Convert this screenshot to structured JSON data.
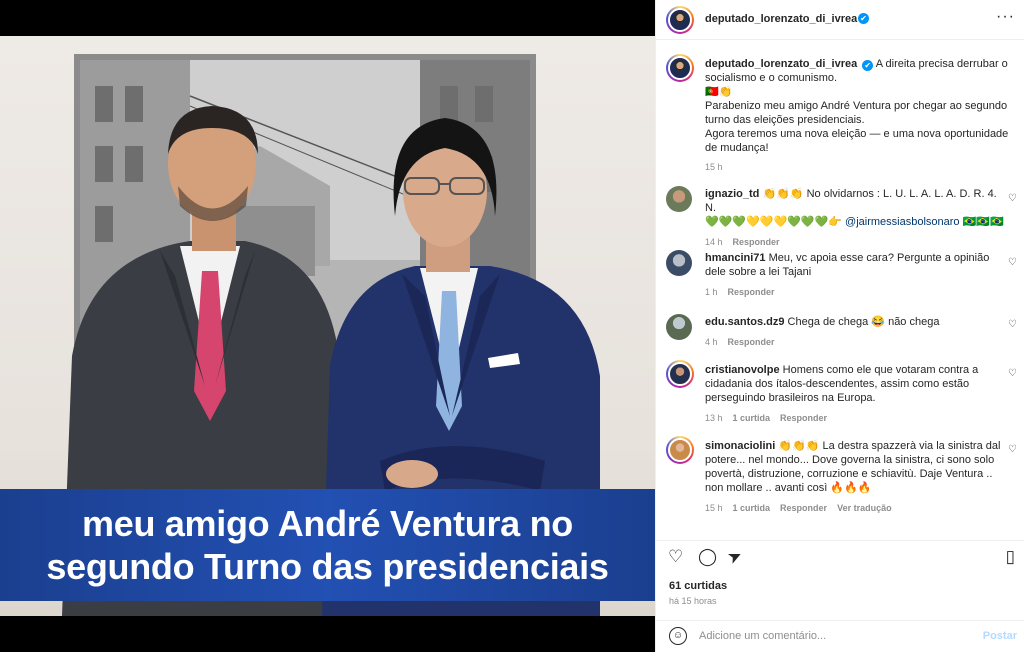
{
  "post": {
    "overlay_line1": "meu amigo André Ventura no",
    "overlay_line2": "segundo Turno das presidenciais"
  },
  "header": {
    "username": "deputado_lorenzato_di_ivrea",
    "verified_icon": "✔",
    "more_icon": "···"
  },
  "caption": {
    "username": "deputado_lorenzato_di_ivrea",
    "line1": "A direita precisa derrubar o",
    "line2": "socialismo e o comunismo.",
    "line3": "🇵🇹👏",
    "line4": "Parabenizo meu amigo André Ventura por chegar ao segundo",
    "line5": "turno das eleições presidenciais.",
    "line6": "Agora teremos uma nova eleição — e uma nova oportunidade",
    "line7": "de mudança!",
    "time": "15 h"
  },
  "comments": [
    {
      "username": "ignazio_td",
      "line1": "👏👏👏 No olvidarnos : L. U. L. A. L. A. D. R. 4. N.",
      "line2_emoji": "💚💚💚💛💛💛💚💚💚👉",
      "line2_mention": "@jairmessiasbolsonaro",
      "line2_tail": "🇧🇷🇧🇷🇧🇷",
      "time": "14 h",
      "reply": "Responder"
    },
    {
      "username": "hmancini71",
      "line1": "Meu, vc apoia esse cara? Pergunte a opinião",
      "line2": "dele sobre a lei Tajani",
      "time": "1 h",
      "reply": "Responder"
    },
    {
      "username": "edu.santos.dz9",
      "line1": "Chega de chega 😂 não chega",
      "time": "4 h",
      "reply": "Responder"
    },
    {
      "username": "cristianovolpe",
      "line1": "Homens como ele que votaram contra a",
      "line2": "cidadania dos ítalos-descendentes, assim como estão",
      "line3": "perseguindo brasileiros na Europa.",
      "time": "13 h",
      "likes": "1 curtida",
      "reply": "Responder"
    },
    {
      "username": "simonaciolini",
      "line1": "👏👏👏 La destra spazzerà via la sinistra dal",
      "line2": "potere... nel mondo... Dove governa la sinistra, ci sono solo",
      "line3": "povertà, distruzione, corruzione e schiavitù. Daje Ventura ..",
      "line4": "non mollare .. avanti così 🔥🔥🔥",
      "time": "15 h",
      "likes": "1 curtida",
      "reply": "Responder",
      "translate": "Ver tradução"
    }
  ],
  "icons": {
    "heart": "♡",
    "comment": "◯",
    "share": "➤",
    "bookmark": "▯",
    "emoji": "☺"
  },
  "footer": {
    "likes": "61 curtidas",
    "time": "há 15 horas",
    "placeholder": "Adicione um comentário...",
    "post_label": "Postar"
  }
}
